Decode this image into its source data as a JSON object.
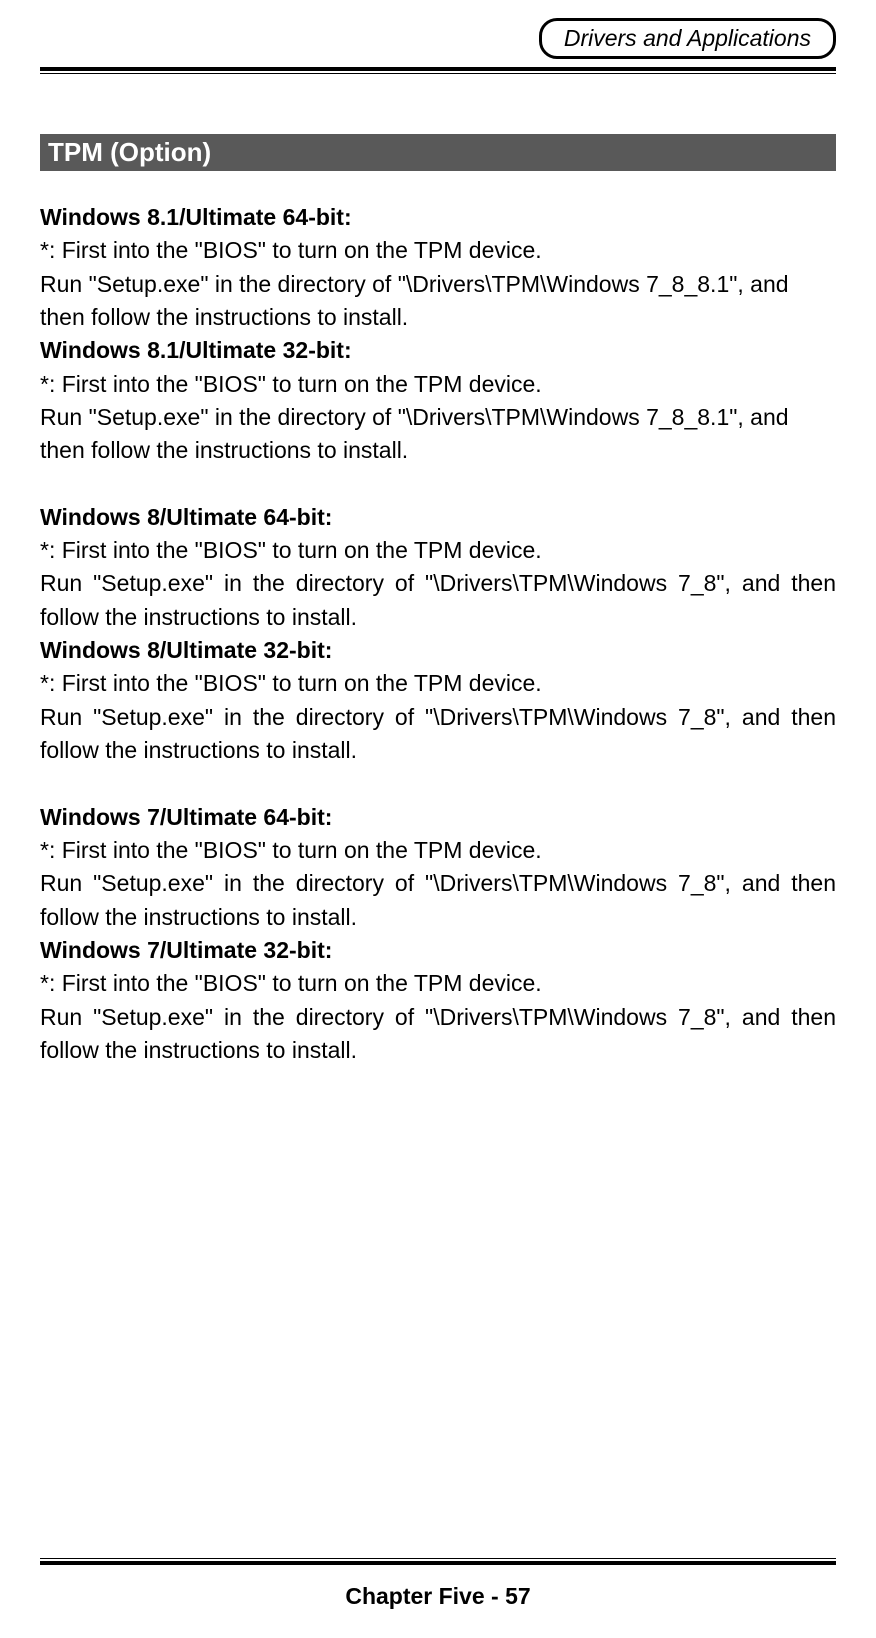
{
  "header": {
    "title": "Drivers and Applications"
  },
  "section": {
    "heading": " TPM (Option)"
  },
  "entries": [
    {
      "os": "Windows 8.1/Ultimate 64-bit:",
      "note": "*: First into the \"BIOS\" to turn on the TPM device.",
      "instruction": "Run \"Setup.exe\" in the directory of \"\\Drivers\\TPM\\Windows 7_8_8.1\", and then follow the instructions to install.",
      "justify": false
    },
    {
      "os": "Windows 8.1/Ultimate 32-bit:",
      "note": "*: First into the \"BIOS\" to turn on the TPM device.",
      "instruction": "Run \"Setup.exe\" in the directory of \"\\Drivers\\TPM\\Windows 7_8_8.1\", and then follow the instructions to install.",
      "justify": false
    },
    {
      "spacer": true
    },
    {
      "os": "Windows 8/Ultimate 64-bit:",
      "note": "*: First into the \"BIOS\" to turn on the TPM device.",
      "instruction": "Run \"Setup.exe\" in the directory of \"\\Drivers\\TPM\\Windows 7_8\", and then follow the instructions to install.",
      "justify": true
    },
    {
      "os": "Windows 8/Ultimate 32-bit:",
      "note": "*: First into the \"BIOS\" to turn on the TPM device.",
      "instruction": "Run \"Setup.exe\" in the directory of \"\\Drivers\\TPM\\Windows 7_8\", and then follow the instructions to install.",
      "justify": true
    },
    {
      "spacer": true
    },
    {
      "os": "Windows 7/Ultimate 64-bit:",
      "note": "*: First into the \"BIOS\" to turn on the TPM device.",
      "instruction": "Run \"Setup.exe\" in the directory of \"\\Drivers\\TPM\\Windows 7_8\", and then follow the instructions to install.",
      "justify": true
    },
    {
      "os": "Windows 7/Ultimate 32-bit:",
      "note": "*: First into the \"BIOS\" to turn on the TPM device.",
      "instruction": "Run \"Setup.exe\" in the directory of \"\\Drivers\\TPM\\Windows 7_8\", and then follow the instructions to install.",
      "justify": true
    }
  ],
  "footer": {
    "text": "Chapter Five - 57"
  }
}
